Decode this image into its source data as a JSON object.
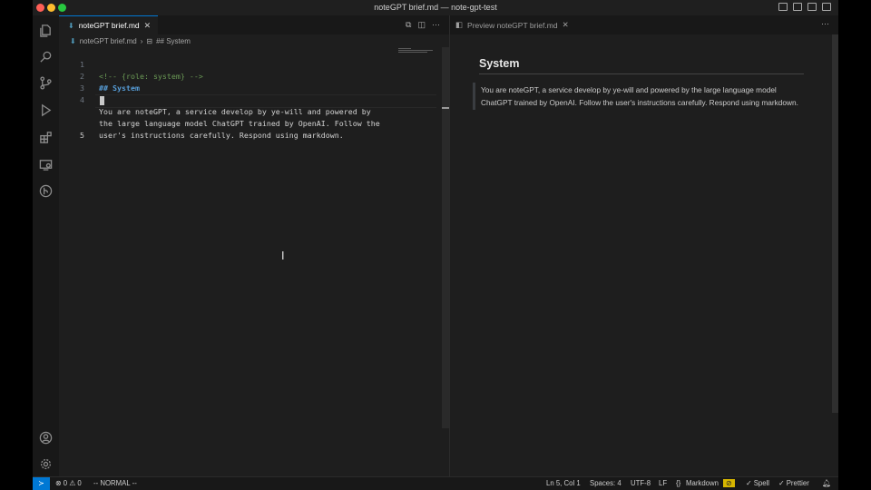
{
  "window": {
    "title": "noteGPT brief.md — note-gpt-test"
  },
  "editor": {
    "tab_label": "noteGPT brief.md",
    "breadcrumb": {
      "file": "noteGPT brief.md",
      "symbol": "## System"
    },
    "lines": [
      {
        "num": "1",
        "text": "<!-- {role: system} -->"
      },
      {
        "num": "2",
        "text": "## System"
      },
      {
        "num": "3",
        "text": ""
      },
      {
        "num": "4",
        "text": "You are noteGPT, a service develop by ye-will and powered by"
      },
      {
        "num": "",
        "text": "the large language model ChatGPT trained by OpenAI. Follow the"
      },
      {
        "num": "",
        "text": "user's instructions carefully. Respond using markdown."
      },
      {
        "num": "5",
        "text": ""
      }
    ]
  },
  "preview": {
    "tab_label": "Preview noteGPT brief.md",
    "heading": "System",
    "quote": "You are noteGPT, a service develop by ye-will and powered by the large language model ChatGPT trained by OpenAI. Follow the user's instructions carefully. Respond using markdown."
  },
  "statusbar": {
    "problems": "⊗ 0 ⚠ 0",
    "mode": "-- NORMAL --",
    "position": "Ln 5, Col 1",
    "spaces": "Spaces: 4",
    "encoding": "UTF-8",
    "eol": "LF",
    "language": "Markdown",
    "spell": "✓ Spell",
    "prettier": "✓ Prettier"
  },
  "icons": [
    "explorer-icon",
    "search-icon",
    "source-control-icon",
    "run-debug-icon",
    "extensions-icon",
    "remote-explorer-icon",
    "git-graph-icon",
    "account-icon",
    "settings-gear-icon"
  ],
  "colors": {
    "accent": "#0078d4",
    "comment": "#6a9955",
    "heading": "#569cd6"
  }
}
